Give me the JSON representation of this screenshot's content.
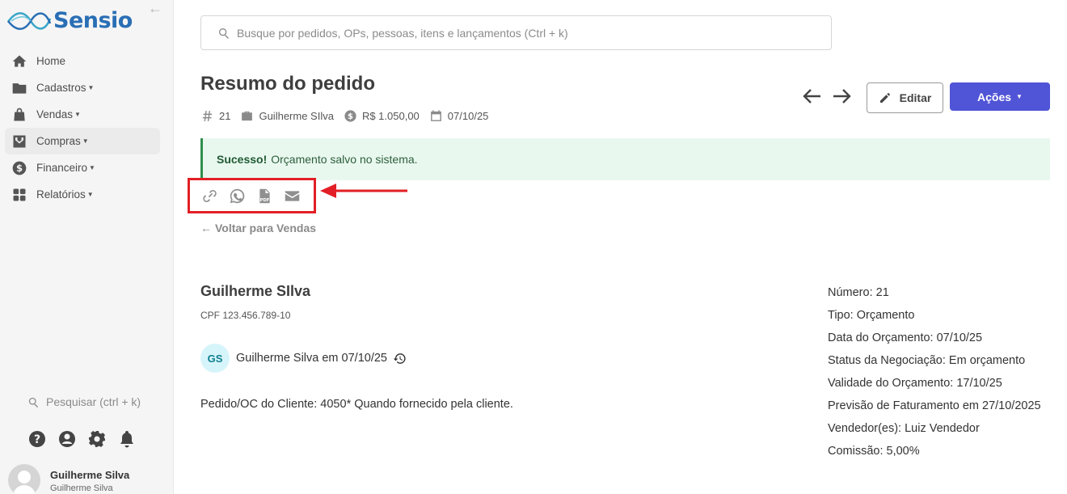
{
  "brand": {
    "name": "Sensio"
  },
  "sidebar": {
    "items": [
      {
        "label": "Home",
        "icon": "home-icon"
      },
      {
        "label": "Cadastros",
        "icon": "folder-icon"
      },
      {
        "label": "Vendas",
        "icon": "bag-icon"
      },
      {
        "label": "Compras",
        "icon": "inbox-icon"
      },
      {
        "label": "Financeiro",
        "icon": "dollar-icon"
      },
      {
        "label": "Relatórios",
        "icon": "grid-icon"
      }
    ],
    "search_label": "Pesquisar (ctrl + k)",
    "user": {
      "name": "Guilherme Silva",
      "subtitle": "Guilherme Silva"
    }
  },
  "search": {
    "placeholder": "Busque por pedidos, OPs, pessoas, itens e lançamentos (Ctrl + k)"
  },
  "header": {
    "title": "Resumo do pedido",
    "order_number": "21",
    "customer": "Guilherme SIlva",
    "amount": "R$ 1.050,00",
    "date": "07/10/25",
    "edit_label": "Editar",
    "actions_label": "Ações"
  },
  "alert": {
    "strong": "Sucesso!",
    "message": "Orçamento salvo no sistema."
  },
  "share_icons": [
    "link-icon",
    "whatsapp-icon",
    "pdf-icon",
    "email-icon"
  ],
  "back_label": "Voltar para Vendas",
  "client": {
    "name": "Guilherme SIlva",
    "cpf": "CPF 123.456.789-10",
    "initials": "GS",
    "created_by": "Guilherme Silva em 07/10/25",
    "oc": "Pedido/OC do Cliente: 4050* Quando fornecido pela cliente."
  },
  "details": {
    "numero": "Número: 21",
    "tipo": "Tipo: Orçamento",
    "data": "Data do Orçamento: 07/10/25",
    "status": "Status da Negociação: Em orçamento",
    "validade": "Validade do Orçamento: 17/10/25",
    "previsao": "Previsão de Faturamento em 27/10/2025",
    "vendedor": "Vendedor(es): Luiz Vendedor",
    "comissao": "Comissão: 5,00%"
  },
  "colors": {
    "accent": "#5054d6",
    "success_bg": "#e9f8ef",
    "highlight": "#e21f26"
  }
}
